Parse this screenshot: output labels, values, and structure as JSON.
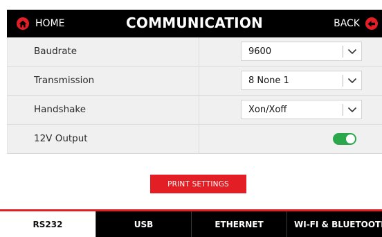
{
  "header": {
    "title": "COMMUNICATION",
    "home_label": "HOME",
    "back_label": "BACK"
  },
  "settings": [
    {
      "label": "Baudrate",
      "value": "9600",
      "type": "select"
    },
    {
      "label": "Transmission",
      "value": "8 None 1",
      "type": "select"
    },
    {
      "label": "Handshake",
      "value": "Xon/Xoff",
      "type": "select"
    },
    {
      "label": "12V Output",
      "type": "toggle",
      "on": true
    }
  ],
  "print_button": {
    "label": "PRINT SETTINGS"
  },
  "tabs": [
    {
      "label": "RS232",
      "active": true
    },
    {
      "label": "USB",
      "active": false
    },
    {
      "label": "ETHERNET",
      "active": false
    },
    {
      "label": "WI-FI & BLUETOOTH",
      "active": false
    }
  ],
  "colors": {
    "accent": "#e31e24",
    "header_bg": "#000000",
    "row_bg": "#f0f0f0",
    "toggle_on": "#2aa74a"
  },
  "icons": {
    "home": "home-icon",
    "back": "back-arrow-icon",
    "dropdown": "chevron-down-icon"
  }
}
